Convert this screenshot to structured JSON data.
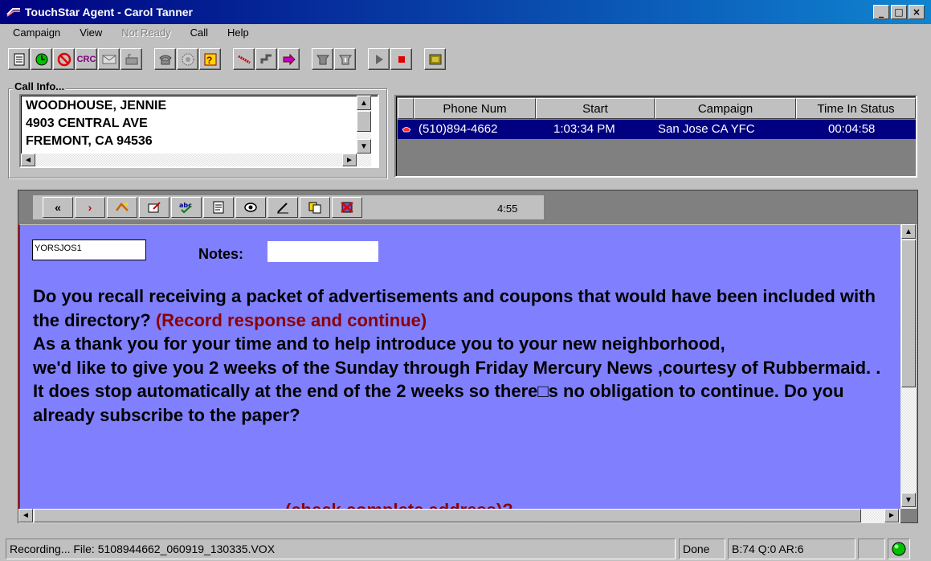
{
  "window": {
    "title": "TouchStar Agent - Carol Tanner",
    "min": "_",
    "max": "□",
    "close": "×"
  },
  "menu": [
    {
      "label": "Campaign",
      "disabled": false
    },
    {
      "label": "View",
      "disabled": false
    },
    {
      "label": "Not Ready",
      "disabled": true
    },
    {
      "label": "Call",
      "disabled": false
    },
    {
      "label": "Help",
      "disabled": false
    }
  ],
  "toolbar": {
    "icons": [
      "notes-icon",
      "ready-icon",
      "not-ready-icon",
      "crc-icon",
      "mail-icon",
      "voicemail-icon",
      "phone-icon",
      "conference-icon",
      "question-icon",
      "hangup-icon",
      "transfer-icon",
      "forward-icon",
      "hold-icon",
      "unhold-icon",
      "play-icon",
      "stop-icon",
      "exit-icon"
    ],
    "crc": "CRC"
  },
  "call_info": {
    "label": "Call Info...",
    "address": [
      "WOODHOUSE, JENNIE",
      "4903  CENTRAL AVE",
      "FREMONT,  CA 94536"
    ]
  },
  "grid": {
    "columns": [
      "Phone Num",
      "Start",
      "Campaign",
      "Time In Status"
    ],
    "rows": [
      {
        "phone": "(510)894-4662",
        "start": "1:03:34 PM",
        "campaign": "San Jose CA YFC",
        "time": "00:04:58"
      }
    ]
  },
  "script": {
    "buttons": [
      "back-double-icon",
      "next-icon",
      "dial-icon",
      "edit-icon",
      "spell-check-icon",
      "form-icon",
      "view-icon",
      "pen-icon",
      "copy-icon",
      "cancel-icon"
    ],
    "back": "«",
    "next": "›",
    "timer": "4:55",
    "code": "YORSJOS1",
    "notes_label": "Notes:",
    "notes_value": "",
    "p1": "Do you recall receiving a packet of advertisements and coupons that would have been included with the directory? ",
    "p1_instr": "(Record response and continue)",
    "p2": "As a thank you for your time and to help introduce you to your new neighborhood,",
    "p3": "we'd like to give you 2 weeks of the Sunday through Friday Mercury News ,courtesy of Rubbermaid. .  It does stop automatically at the end of the 2 weeks so there□s no obligation to continue.  Do you already subscribe to the paper?",
    "cut_text": "(check complete address)?"
  },
  "status": {
    "recording": "Recording... File: 5108944662_060919_130335.VOX",
    "done": "Done",
    "stats": "B:74 Q:0 AR:6",
    "colors": {
      "led": "#00c000"
    }
  }
}
